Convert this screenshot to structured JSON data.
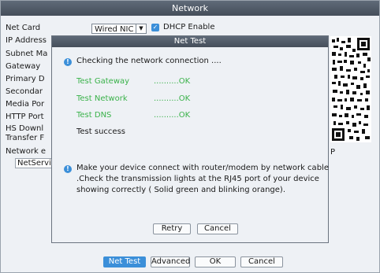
{
  "window": {
    "title": "Network"
  },
  "form": {
    "net_card_label": "Net Card",
    "net_card_value": "Wired NIC",
    "dhcp_label": "DHCP Enable",
    "fields": [
      {
        "label": "IP Address"
      },
      {
        "label": "Subnet Ma"
      },
      {
        "label": "Gateway"
      },
      {
        "label": "Primary D"
      },
      {
        "label": "Secondar"
      },
      {
        "label": "Media Por"
      },
      {
        "label": "HTTP Port"
      },
      {
        "label": "HS Downl"
      },
      {
        "label": "Transfer F"
      },
      {
        "label": "Network e"
      }
    ],
    "net_service_label": "NetServic",
    "p_text": "P"
  },
  "buttons": {
    "net_test": "Net Test",
    "advanced": "Advanced",
    "ok": "OK",
    "cancel": "Cancel"
  },
  "dialog": {
    "title": "Net Test",
    "checking": "Checking the network connection ....",
    "tests": [
      {
        "name": "Test Gateway",
        "result": "..........OK"
      },
      {
        "name": "Test Network",
        "result": "..........OK"
      },
      {
        "name": "Test DNS",
        "result": "..........OK"
      }
    ],
    "success": "Test success",
    "note_line1": "Make your device connect with router/modem by network cable",
    "note_line2": ".Check the transmission lights at the RJ45 port of your device",
    "note_line3": "showing correctly ( Solid green and blinking orange).",
    "retry": "Retry",
    "cancel": "Cancel"
  },
  "icons": {
    "info": "info-icon",
    "check": "checkbox-checked-icon",
    "dropdown": "chevron-down-icon"
  },
  "colors": {
    "accent": "#3b8fd9",
    "success": "#3ab24a",
    "titlebar": "#4f5966"
  }
}
